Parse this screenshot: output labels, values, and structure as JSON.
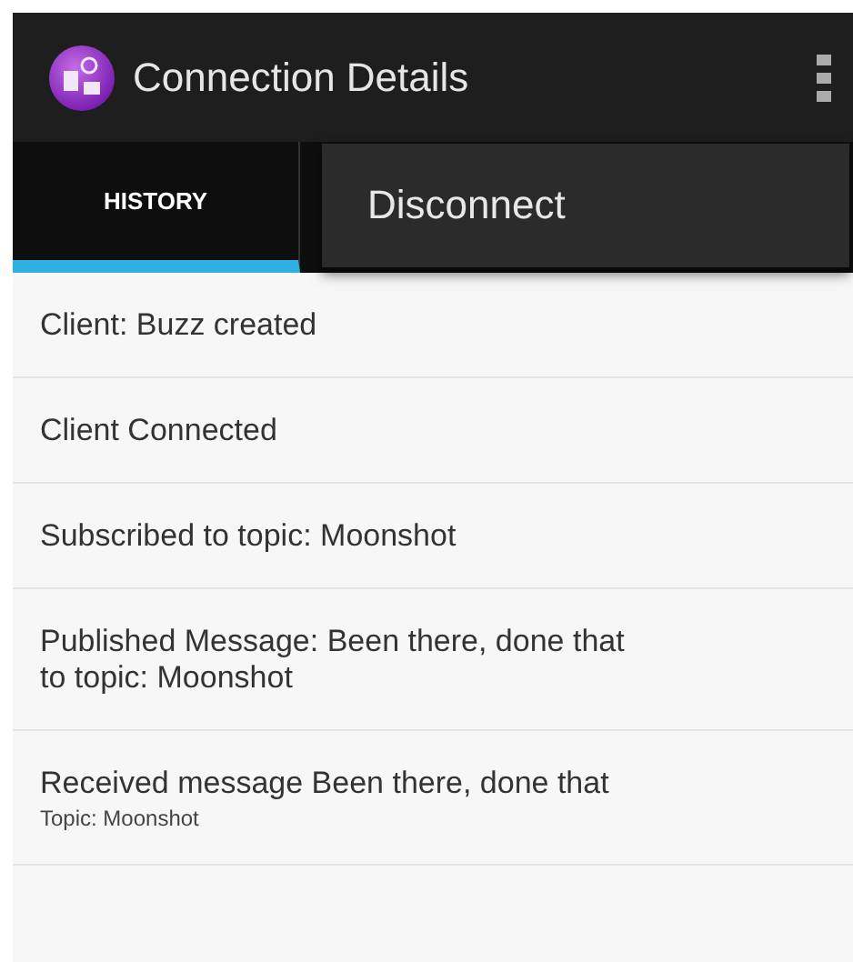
{
  "action_bar": {
    "title": "Connection Details"
  },
  "tabs": [
    {
      "label": "HISTORY",
      "selected": true
    }
  ],
  "menu": {
    "items": [
      "Disconnect"
    ]
  },
  "history": [
    {
      "text": "Client: Buzz created"
    },
    {
      "text": "Client Connected"
    },
    {
      "text": "Subscribed to topic: Moonshot"
    },
    {
      "text": "Published Message: Been there, done that to topic: Moonshot"
    },
    {
      "text": "Received message Been there, done that",
      "subtitle": "Topic: Moonshot"
    }
  ]
}
